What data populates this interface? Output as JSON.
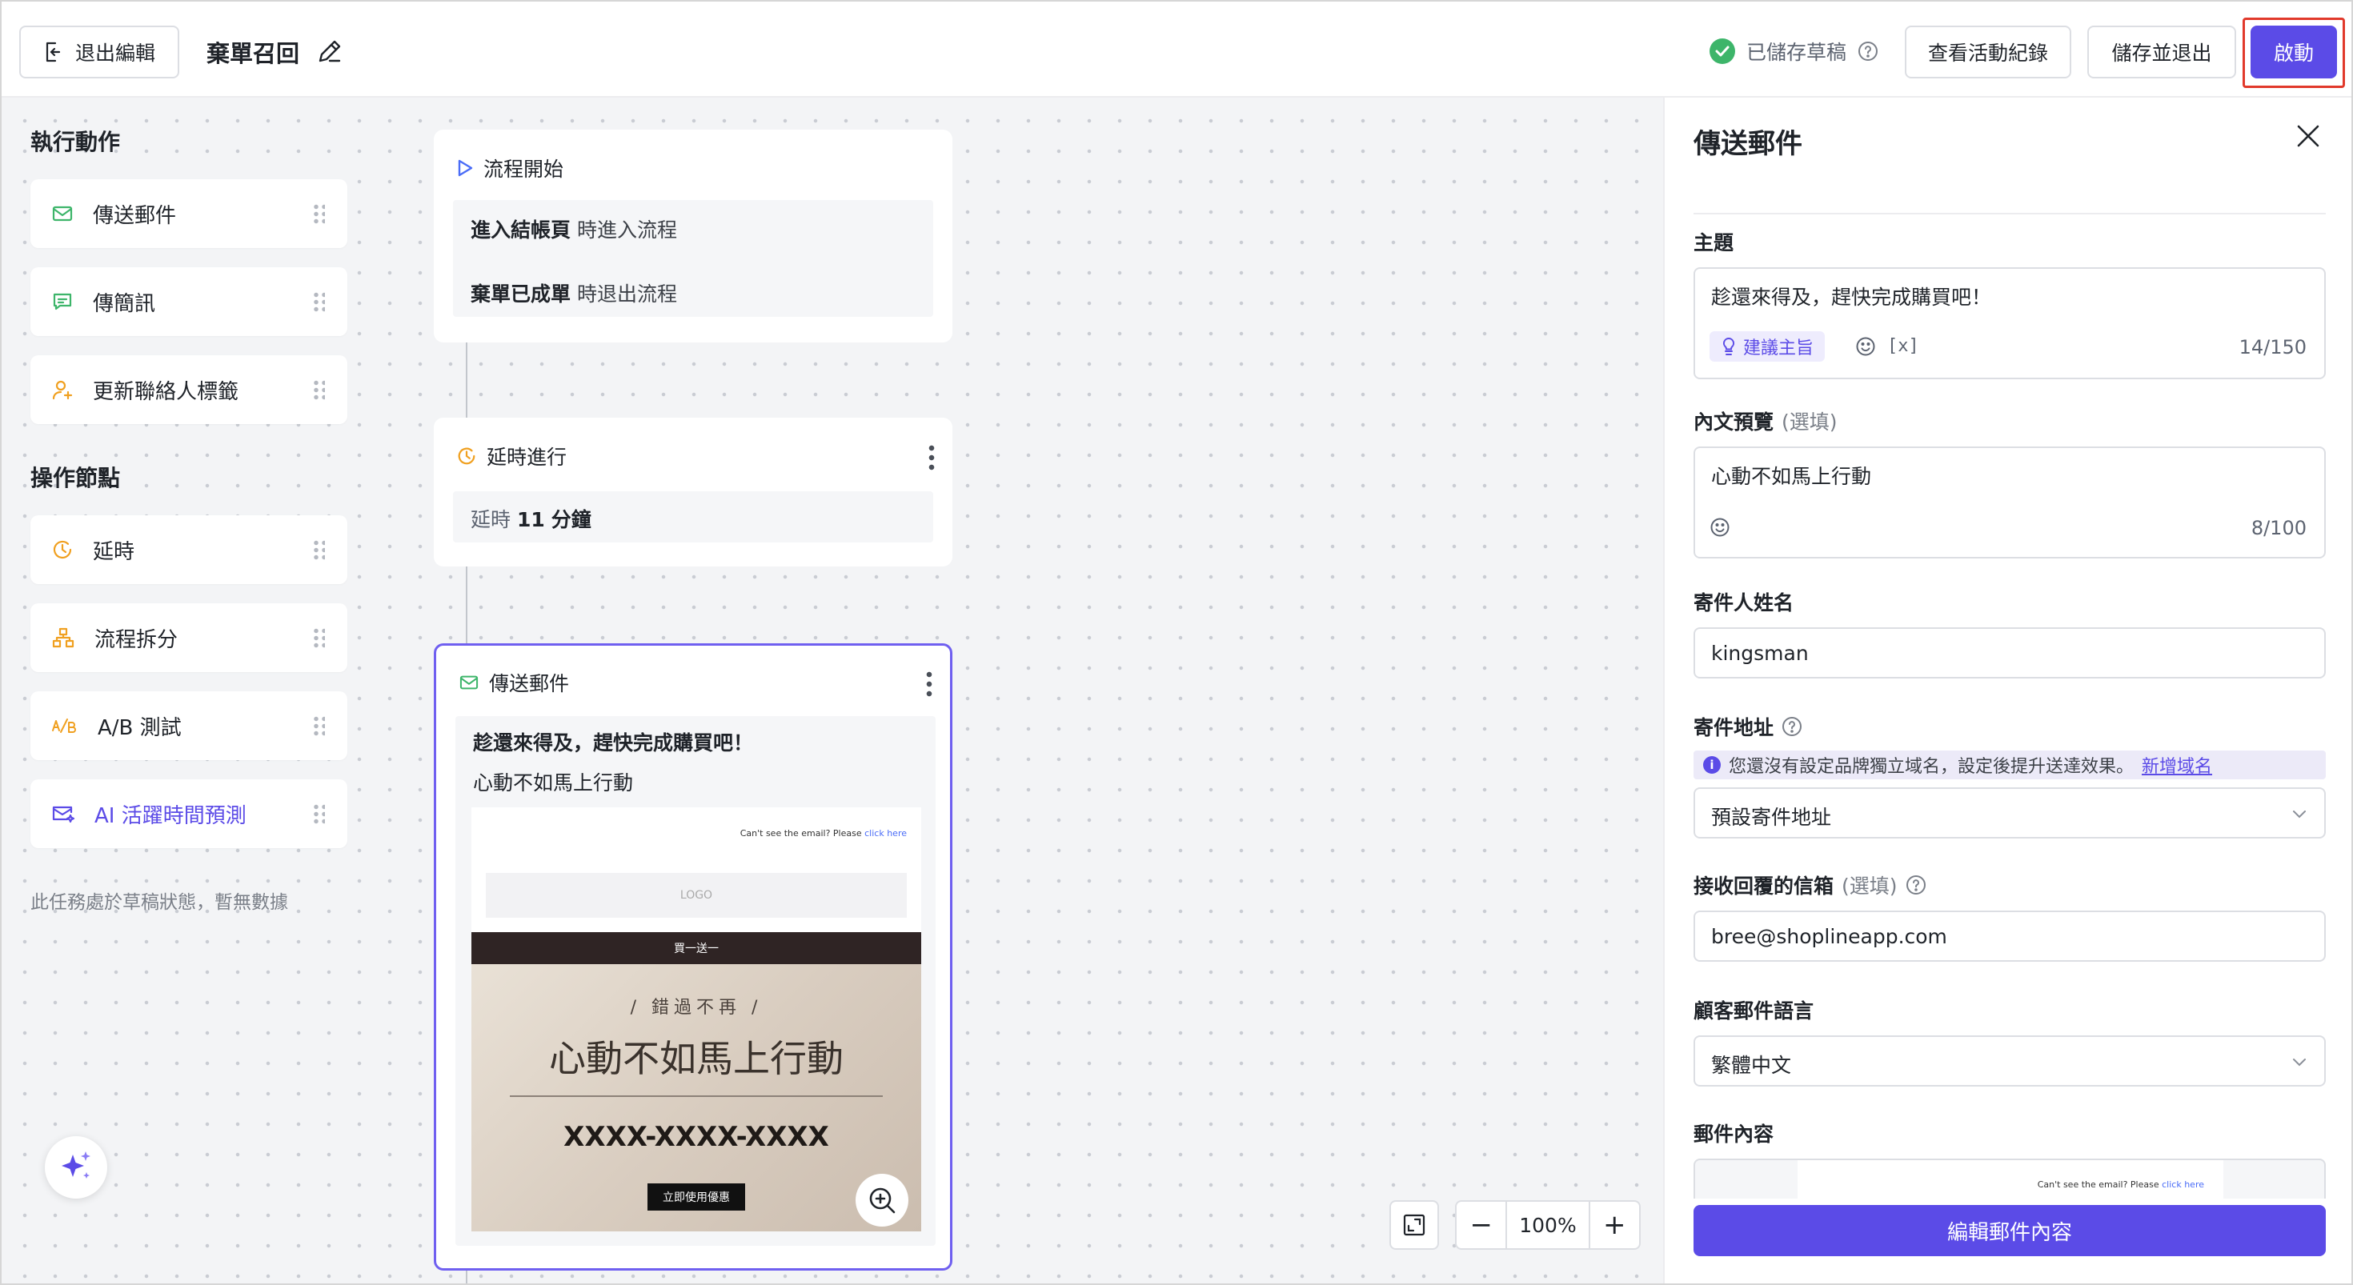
{
  "header": {
    "exit_label": "退出編輯",
    "flow_title": "棄單召回",
    "saved_status": "已儲存草稿",
    "view_log_label": "查看活動紀錄",
    "save_exit_label": "儲存並退出",
    "launch_label": "啟動"
  },
  "palette": {
    "actions_title": "執行動作",
    "actions": [
      {
        "label": "傳送郵件",
        "icon": "mail-icon"
      },
      {
        "label": "傳簡訊",
        "icon": "sms-icon"
      },
      {
        "label": "更新聯絡人標籤",
        "icon": "contact-tag-icon"
      }
    ],
    "operations_title": "操作節點",
    "operations": [
      {
        "label": "延時",
        "icon": "clock-icon"
      },
      {
        "label": "流程拆分",
        "icon": "split-icon"
      },
      {
        "label": "A/B 測試",
        "icon": "ab-test-icon"
      },
      {
        "label": "AI 活躍時間預測",
        "icon": "ai-mail-icon"
      }
    ],
    "empty_note": "此任務處於草稿狀態，暫無數據"
  },
  "flow": {
    "start": {
      "title": "流程開始",
      "rule1_bold": "進入結帳頁",
      "rule1_text": "時進入流程",
      "rule2_bold": "棄單已成單",
      "rule2_text": "時退出流程"
    },
    "delay": {
      "title": "延時進行",
      "prefix": "延時",
      "value": "11",
      "unit": "分鐘"
    },
    "email": {
      "title": "傳送郵件",
      "subject": "趁還來得及，趕快完成購買吧！",
      "preview": "心動不如馬上行動",
      "email_top_note": "Can't see the email? Please",
      "email_top_link": "click here",
      "logo_placeholder": "LOGO",
      "banner": "買一送一",
      "hero_sub": "/ 錯過不再 /",
      "hero_title": "心動不如馬上行動",
      "coupon_code": "XXXX-XXXX-XXXX",
      "cta": "立即使用優惠"
    }
  },
  "zoom": {
    "level": "100%",
    "minus": "−",
    "plus": "+"
  },
  "panel": {
    "title": "傳送郵件",
    "subject_label": "主題",
    "subject_value": "趁還來得及，趕快完成購買吧！",
    "suggest_label": "建議主旨",
    "variable_label": "[x]",
    "subject_count": "14/150",
    "preview_label": "內文預覽",
    "preview_optional": "(選填)",
    "preview_value": "心動不如馬上行動",
    "preview_count": "8/100",
    "sender_name_label": "寄件人姓名",
    "sender_name_value": "kingsman",
    "sender_addr_label": "寄件地址",
    "domain_info": "您還沒有設定品牌獨立域名，設定後提升送達效果。",
    "domain_link": "新增域名",
    "sender_addr_value": "預設寄件地址",
    "reply_label": "接收回覆的信箱",
    "reply_optional": "(選填)",
    "reply_value": "bree@shoplineapp.com",
    "language_label": "顧客郵件語言",
    "language_value": "繁體中文",
    "content_label": "郵件內容",
    "content_note": "Can't see the email? Please",
    "content_link": "click here",
    "edit_content_label": "編輯郵件內容"
  },
  "colors": {
    "accent": "#5b4be7",
    "success": "#3db56a",
    "highlight_outline": "#e1392b",
    "canvas": "#f3f4f6"
  }
}
